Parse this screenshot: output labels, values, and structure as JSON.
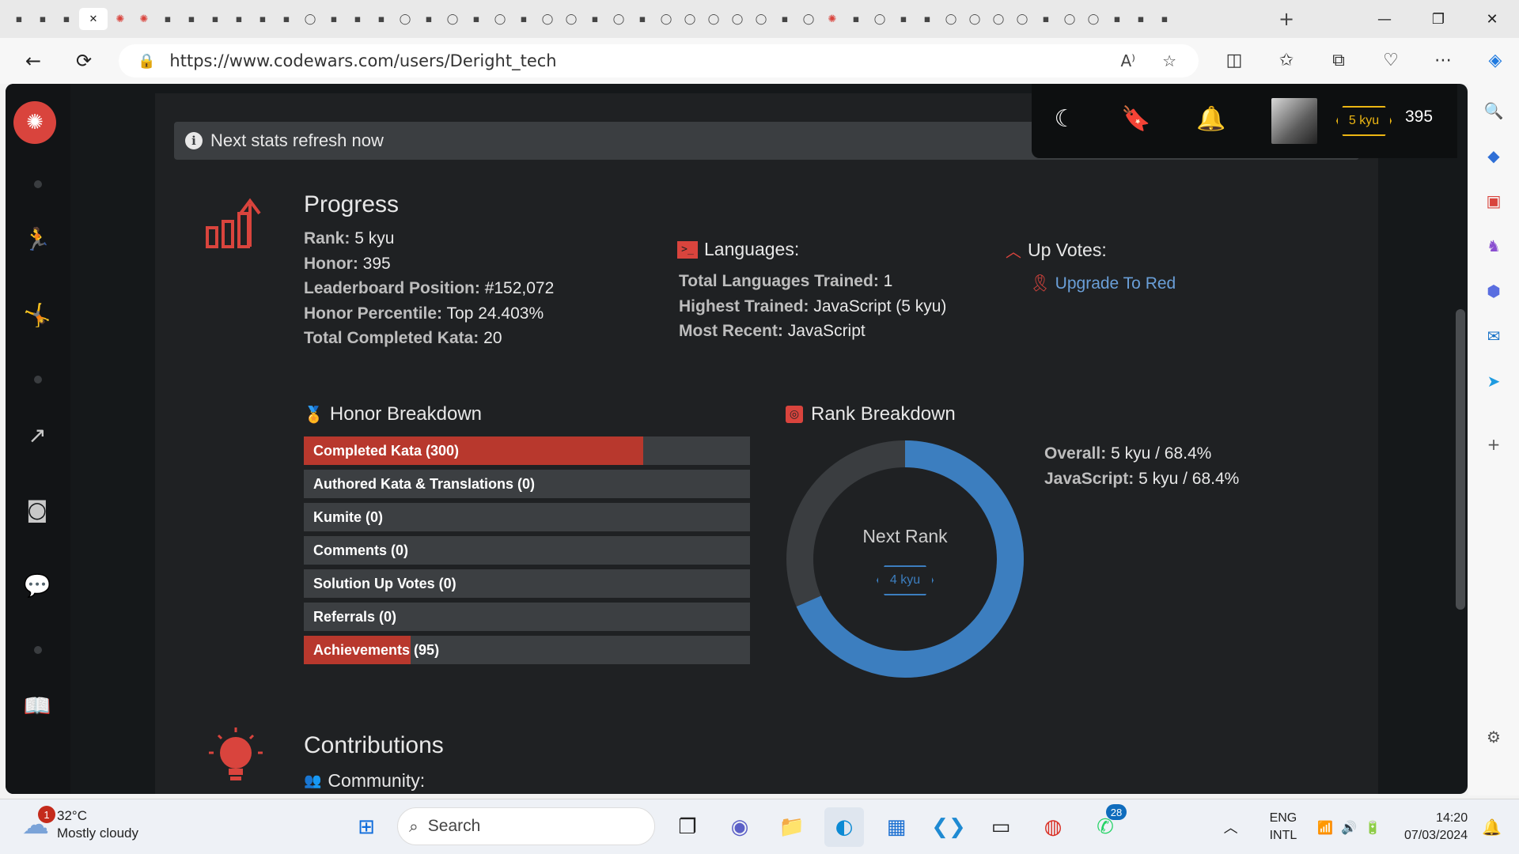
{
  "browser": {
    "url": "https://www.codewars.com/users/Deright_tech",
    "tab_icons": [
      "profile-icon",
      "tab-overview-icon",
      "gmail-icon",
      "codewars-tab-icon",
      "codewars-tab-icon-2",
      "codewars-tab-icon-3",
      "stackoverflow-icon",
      "search-icon",
      "help-icon",
      "document-icon",
      "avatar-icon",
      "document-icon-2",
      "github-icon",
      "stackoverflow-icon-2",
      "medium-icon",
      "code-icon",
      "github-icon-2",
      "stackoverflow-icon-3",
      "github-icon-3",
      "stackoverflow-icon-4",
      "github-icon-4",
      "globe-icon",
      "github-icon-5",
      "github-icon-6",
      "video-icon",
      "github-icon-7",
      "reddit-icon",
      "github-icon-8",
      "github-icon-9",
      "github-icon-10",
      "github-icon-11",
      "github-icon-12",
      "stackoverflow-icon-5",
      "github-icon-13",
      "codewars-tab-icon-4",
      "video-icon-2",
      "github-icon-14",
      "video-icon-3",
      "globe-icon-2",
      "github-icon-15",
      "github-icon-16",
      "github-icon-17",
      "github-icon-18",
      "dots-icon",
      "github-icon-19",
      "github-icon-20",
      "stackoverflow-icon-6",
      "video-icon-4",
      "stackoverflow-icon-7"
    ]
  },
  "notice": {
    "text": "Next stats refresh now"
  },
  "topnav": {
    "rank": "5 kyu",
    "honor": "395"
  },
  "progress": {
    "title": "Progress",
    "stats": [
      {
        "key": "Rank:",
        "value": "5 kyu"
      },
      {
        "key": "Honor:",
        "value": "395"
      },
      {
        "key": "Leaderboard Position:",
        "value": "#152,072"
      },
      {
        "key": "Honor Percentile:",
        "value": "Top 24.403%"
      },
      {
        "key": "Total Completed Kata:",
        "value": "20"
      }
    ]
  },
  "languages": {
    "title": "Languages:",
    "stats": [
      {
        "key": "Total Languages Trained:",
        "value": "1"
      },
      {
        "key": "Highest Trained:",
        "value": "JavaScript (5 kyu)"
      },
      {
        "key": "Most Recent:",
        "value": "JavaScript"
      }
    ]
  },
  "upvotes": {
    "title": "Up Votes:",
    "link": "Upgrade To Red"
  },
  "honor_breakdown": {
    "title": "Honor Breakdown",
    "bars": [
      {
        "label": "Completed Kata (300)",
        "fraction": 0.76
      },
      {
        "label": "Authored Kata & Translations (0)",
        "fraction": 0
      },
      {
        "label": "Kumite (0)",
        "fraction": 0
      },
      {
        "label": "Comments (0)",
        "fraction": 0
      },
      {
        "label": "Solution Up Votes (0)",
        "fraction": 0
      },
      {
        "label": "Referrals (0)",
        "fraction": 0
      },
      {
        "label": "Achievements (95)",
        "fraction": 0.24
      }
    ],
    "fill_color": "#b8382d"
  },
  "rank_breakdown": {
    "title": "Rank Breakdown",
    "progress_percent": 68.4,
    "center_label": "Next Rank",
    "next_rank": "4 kyu",
    "stats": [
      {
        "key": "Overall:",
        "value": "5 kyu / 68.4%"
      },
      {
        "key": "JavaScript:",
        "value": "5 kyu / 68.4%"
      }
    ],
    "ring_color": "#3c7ebf",
    "track_color": "#3a3d40"
  },
  "contributions": {
    "title": "Contributions",
    "community": "Community:"
  },
  "taskbar": {
    "weather_temp": "32°C",
    "weather_desc": "Mostly cloudy",
    "weather_badge": "1",
    "search_placeholder": "Search",
    "whatsapp_badge": "28",
    "lang_top": "ENG",
    "lang_bottom": "INTL",
    "time": "14:20",
    "date": "07/03/2024"
  },
  "colors": {
    "accent_red": "#d9443d",
    "badge_yellow": "#ecb613",
    "link_blue": "#6a9fd8"
  }
}
